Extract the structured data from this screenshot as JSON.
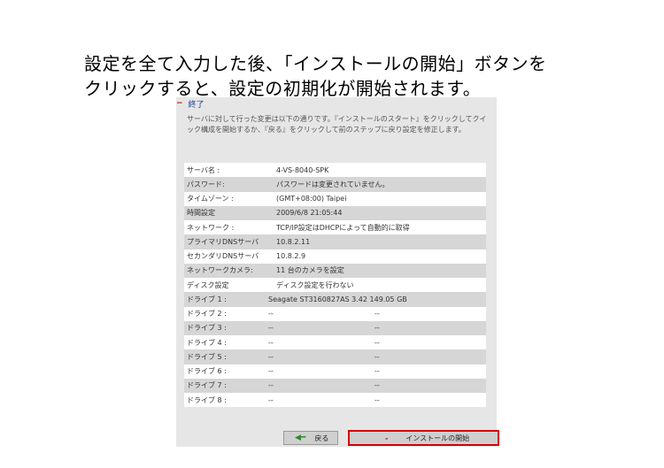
{
  "caption": {
    "line1": "設定を全て入力した後、「インストールの開始」ボタンを",
    "line2": "クリックすると、設定の初期化が開始されます。"
  },
  "section": {
    "title": "終了",
    "intro": "サーバに対して行った変更は以下の通りです。『インストールのスタート』をクリックしてクイック構成を開始するか、『戻る』をクリックして前のステップに戻り設定を修正します。"
  },
  "summary": [
    {
      "label": "サーバ名 :",
      "value": "4-VS-8040-SPK"
    },
    {
      "label": "パスワード:",
      "value": "パスワードは変更されていません。"
    },
    {
      "label": "タイムゾーン :",
      "value": "(GMT+08:00) Taipei"
    },
    {
      "label": "時間設定",
      "value": "2009/6/8 21:05:44"
    },
    {
      "label": "ネットワーク :",
      "value": "TCP/IP設定はDHCPによって自動的に取得"
    },
    {
      "label": "プライマリDNSサーバ",
      "value": "10.8.2.11"
    },
    {
      "label": "セカンダリDNSサーバ",
      "value": "10.8.2.9"
    },
    {
      "label": "ネットワークカメラ:",
      "value": "11 台のカメラを設定"
    },
    {
      "label": "ディスク設定",
      "value": "ディスク設定を行わない"
    }
  ],
  "drives": [
    {
      "label": "ドライブ 1 :",
      "model": "Seagate ST3160827AS 3.42  149.05 GB",
      "size": ""
    },
    {
      "label": "ドライブ 2 :",
      "model": "--",
      "size": "--"
    },
    {
      "label": "ドライブ 3 :",
      "model": "--",
      "size": "--"
    },
    {
      "label": "ドライブ 4 :",
      "model": "--",
      "size": "--"
    },
    {
      "label": "ドライブ 5 :",
      "model": "--",
      "size": "--"
    },
    {
      "label": "ドライブ 6 :",
      "model": "--",
      "size": "--"
    },
    {
      "label": "ドライブ 7 :",
      "model": "--",
      "size": "--"
    },
    {
      "label": "ドライブ 8 :",
      "model": "--",
      "size": "--"
    }
  ],
  "buttons": {
    "back_label": "戻る",
    "install_label": "インストールの開始"
  },
  "colors": {
    "highlight_border": "#d40000",
    "title_color": "#1f3f9a"
  }
}
